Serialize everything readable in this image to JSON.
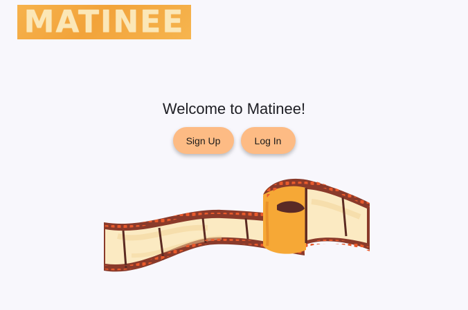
{
  "logo": {
    "text": "MATINEE"
  },
  "welcome": {
    "title": "Welcome to Matinee!"
  },
  "buttons": {
    "signup_label": "Sign Up",
    "login_label": "Log In"
  },
  "colors": {
    "background": "#f8f7fc",
    "logo_orange": "#f2a33a",
    "logo_text": "#fbe7b7",
    "button_peach": "#fdbb84",
    "film_edge": "#8a3a2a",
    "film_hole": "#e85a2c",
    "film_frame": "#fbeac2",
    "film_curl": "#f6a836"
  },
  "illustration": {
    "icon": "film-strip-icon"
  }
}
